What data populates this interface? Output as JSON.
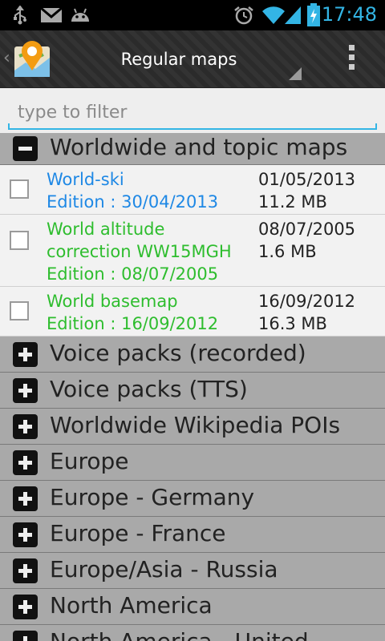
{
  "status": {
    "time": "17:48",
    "icons": [
      "usb-icon",
      "gmail-icon",
      "android-icon",
      "alarm-icon",
      "wifi-icon",
      "signal-icon",
      "battery-icon"
    ]
  },
  "actionbar": {
    "title": "Regular maps"
  },
  "filter": {
    "placeholder": "type to filter",
    "value": ""
  },
  "colors": {
    "accent": "#33b5e5",
    "installed_outdated": "#1e88e5",
    "not_installed": "#2ebd2e"
  },
  "groups": [
    {
      "label": "Worldwide and topic maps",
      "expanded": true,
      "items": [
        {
          "name": "World-ski",
          "edition": "Edition : 30/04/2013",
          "date": "01/05/2013",
          "size": "11.2 MB",
          "color": "#1e88e5"
        },
        {
          "name": "World altitude correction WW15MGH",
          "edition": "Edition : 08/07/2005",
          "date": "08/07/2005",
          "size": "1.6 MB",
          "color": "#2ebd2e"
        },
        {
          "name": "World basemap",
          "edition": "Edition : 16/09/2012",
          "date": "16/09/2012",
          "size": "16.3 MB",
          "color": "#2ebd2e"
        }
      ]
    },
    {
      "label": "Voice packs (recorded)",
      "expanded": false
    },
    {
      "label": "Voice packs (TTS)",
      "expanded": false
    },
    {
      "label": "Worldwide Wikipedia POIs",
      "expanded": false
    },
    {
      "label": "Europe",
      "expanded": false
    },
    {
      "label": "Europe - Germany",
      "expanded": false
    },
    {
      "label": "Europe - France",
      "expanded": false
    },
    {
      "label": "Europe/Asia - Russia",
      "expanded": false
    },
    {
      "label": "North America",
      "expanded": false
    },
    {
      "label": "North America - United",
      "expanded": false
    }
  ]
}
